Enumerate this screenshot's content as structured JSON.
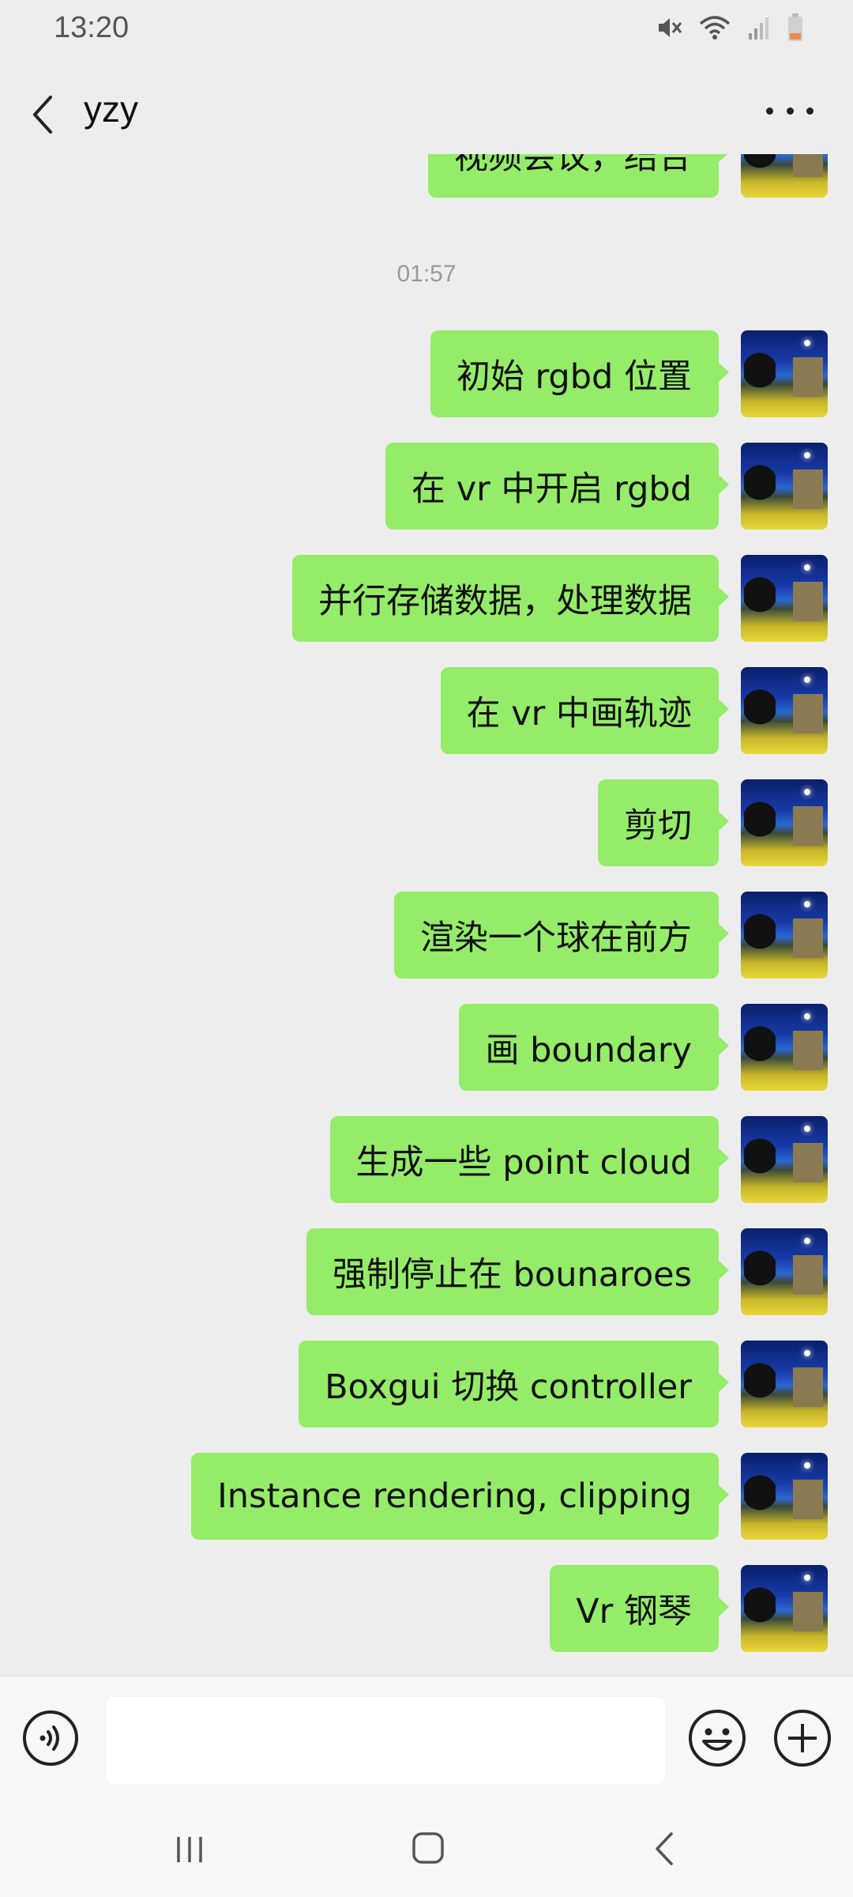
{
  "status_bar": {
    "time": "13:20",
    "icons": [
      "mute-icon",
      "wifi-icon",
      "signal-icon",
      "battery-icon"
    ]
  },
  "header": {
    "title": "yzy",
    "back_icon": "chevron-left-icon",
    "more_icon": "more-icon"
  },
  "chat": {
    "partial_message": "视频会议，结合",
    "timestamp": "01:57",
    "messages": [
      {
        "text": "初始 rgbd 位置"
      },
      {
        "text": "在 vr 中开启 rgbd"
      },
      {
        "text": "并行存储数据，处理数据"
      },
      {
        "text": "在 vr 中画轨迹"
      },
      {
        "text": "剪切"
      },
      {
        "text": "渲染一个球在前方"
      },
      {
        "text": "画 boundary"
      },
      {
        "text": "生成一些 point cloud"
      },
      {
        "text": "强制停止在 bounaroes"
      },
      {
        "text": "Boxgui 切换 controller"
      },
      {
        "text": "Instance rendering, clipping"
      },
      {
        "text": "Vr 钢琴"
      }
    ]
  },
  "input_bar": {
    "value": "",
    "icons": [
      "voice-icon",
      "emoji-icon",
      "plus-icon"
    ]
  },
  "nav_bar": {
    "icons": [
      "recent-apps-icon",
      "home-icon",
      "back-icon"
    ]
  },
  "colors": {
    "bubble": "#95ec69",
    "background": "#ededed",
    "input_bar": "#f7f7f7"
  }
}
